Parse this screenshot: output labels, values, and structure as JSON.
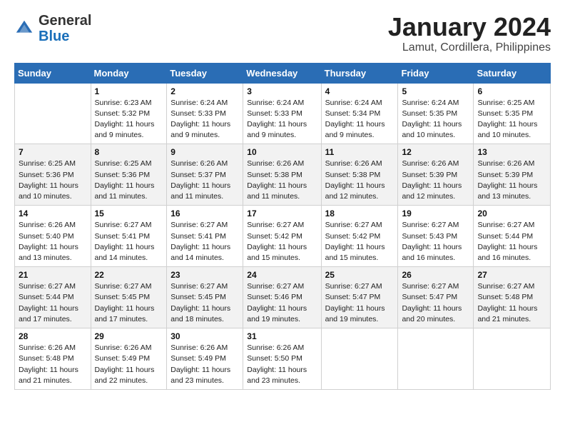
{
  "header": {
    "logo_general": "General",
    "logo_blue": "Blue",
    "month_title": "January 2024",
    "location": "Lamut, Cordillera, Philippines"
  },
  "days_of_week": [
    "Sunday",
    "Monday",
    "Tuesday",
    "Wednesday",
    "Thursday",
    "Friday",
    "Saturday"
  ],
  "weeks": [
    [
      {
        "num": "",
        "info": ""
      },
      {
        "num": "1",
        "info": "Sunrise: 6:23 AM\nSunset: 5:32 PM\nDaylight: 11 hours\nand 9 minutes."
      },
      {
        "num": "2",
        "info": "Sunrise: 6:24 AM\nSunset: 5:33 PM\nDaylight: 11 hours\nand 9 minutes."
      },
      {
        "num": "3",
        "info": "Sunrise: 6:24 AM\nSunset: 5:33 PM\nDaylight: 11 hours\nand 9 minutes."
      },
      {
        "num": "4",
        "info": "Sunrise: 6:24 AM\nSunset: 5:34 PM\nDaylight: 11 hours\nand 9 minutes."
      },
      {
        "num": "5",
        "info": "Sunrise: 6:24 AM\nSunset: 5:35 PM\nDaylight: 11 hours\nand 10 minutes."
      },
      {
        "num": "6",
        "info": "Sunrise: 6:25 AM\nSunset: 5:35 PM\nDaylight: 11 hours\nand 10 minutes."
      }
    ],
    [
      {
        "num": "7",
        "info": "Sunrise: 6:25 AM\nSunset: 5:36 PM\nDaylight: 11 hours\nand 10 minutes."
      },
      {
        "num": "8",
        "info": "Sunrise: 6:25 AM\nSunset: 5:36 PM\nDaylight: 11 hours\nand 11 minutes."
      },
      {
        "num": "9",
        "info": "Sunrise: 6:26 AM\nSunset: 5:37 PM\nDaylight: 11 hours\nand 11 minutes."
      },
      {
        "num": "10",
        "info": "Sunrise: 6:26 AM\nSunset: 5:38 PM\nDaylight: 11 hours\nand 11 minutes."
      },
      {
        "num": "11",
        "info": "Sunrise: 6:26 AM\nSunset: 5:38 PM\nDaylight: 11 hours\nand 12 minutes."
      },
      {
        "num": "12",
        "info": "Sunrise: 6:26 AM\nSunset: 5:39 PM\nDaylight: 11 hours\nand 12 minutes."
      },
      {
        "num": "13",
        "info": "Sunrise: 6:26 AM\nSunset: 5:39 PM\nDaylight: 11 hours\nand 13 minutes."
      }
    ],
    [
      {
        "num": "14",
        "info": "Sunrise: 6:26 AM\nSunset: 5:40 PM\nDaylight: 11 hours\nand 13 minutes."
      },
      {
        "num": "15",
        "info": "Sunrise: 6:27 AM\nSunset: 5:41 PM\nDaylight: 11 hours\nand 14 minutes."
      },
      {
        "num": "16",
        "info": "Sunrise: 6:27 AM\nSunset: 5:41 PM\nDaylight: 11 hours\nand 14 minutes."
      },
      {
        "num": "17",
        "info": "Sunrise: 6:27 AM\nSunset: 5:42 PM\nDaylight: 11 hours\nand 15 minutes."
      },
      {
        "num": "18",
        "info": "Sunrise: 6:27 AM\nSunset: 5:42 PM\nDaylight: 11 hours\nand 15 minutes."
      },
      {
        "num": "19",
        "info": "Sunrise: 6:27 AM\nSunset: 5:43 PM\nDaylight: 11 hours\nand 16 minutes."
      },
      {
        "num": "20",
        "info": "Sunrise: 6:27 AM\nSunset: 5:44 PM\nDaylight: 11 hours\nand 16 minutes."
      }
    ],
    [
      {
        "num": "21",
        "info": "Sunrise: 6:27 AM\nSunset: 5:44 PM\nDaylight: 11 hours\nand 17 minutes."
      },
      {
        "num": "22",
        "info": "Sunrise: 6:27 AM\nSunset: 5:45 PM\nDaylight: 11 hours\nand 17 minutes."
      },
      {
        "num": "23",
        "info": "Sunrise: 6:27 AM\nSunset: 5:45 PM\nDaylight: 11 hours\nand 18 minutes."
      },
      {
        "num": "24",
        "info": "Sunrise: 6:27 AM\nSunset: 5:46 PM\nDaylight: 11 hours\nand 19 minutes."
      },
      {
        "num": "25",
        "info": "Sunrise: 6:27 AM\nSunset: 5:47 PM\nDaylight: 11 hours\nand 19 minutes."
      },
      {
        "num": "26",
        "info": "Sunrise: 6:27 AM\nSunset: 5:47 PM\nDaylight: 11 hours\nand 20 minutes."
      },
      {
        "num": "27",
        "info": "Sunrise: 6:27 AM\nSunset: 5:48 PM\nDaylight: 11 hours\nand 21 minutes."
      }
    ],
    [
      {
        "num": "28",
        "info": "Sunrise: 6:26 AM\nSunset: 5:48 PM\nDaylight: 11 hours\nand 21 minutes."
      },
      {
        "num": "29",
        "info": "Sunrise: 6:26 AM\nSunset: 5:49 PM\nDaylight: 11 hours\nand 22 minutes."
      },
      {
        "num": "30",
        "info": "Sunrise: 6:26 AM\nSunset: 5:49 PM\nDaylight: 11 hours\nand 23 minutes."
      },
      {
        "num": "31",
        "info": "Sunrise: 6:26 AM\nSunset: 5:50 PM\nDaylight: 11 hours\nand 23 minutes."
      },
      {
        "num": "",
        "info": ""
      },
      {
        "num": "",
        "info": ""
      },
      {
        "num": "",
        "info": ""
      }
    ]
  ]
}
